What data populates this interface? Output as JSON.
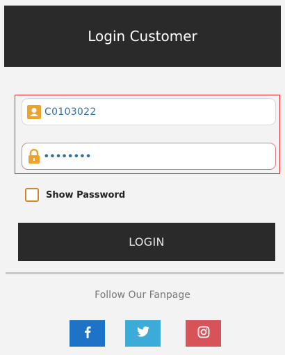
{
  "header": {
    "title": "Login Customer"
  },
  "login_form": {
    "username": {
      "value": "C0103022",
      "icon": "user-icon"
    },
    "password": {
      "value": "••••••••",
      "icon": "lock-icon"
    },
    "show_password": {
      "label": "Show Password",
      "checked": false
    },
    "login_button": {
      "label": "LOGIN"
    }
  },
  "footer": {
    "follow_text": "Follow Our Fanpage",
    "social": [
      {
        "name": "facebook",
        "icon": "facebook-icon",
        "color": "#1f73c7"
      },
      {
        "name": "twitter",
        "icon": "twitter-icon",
        "color": "#3dabd8"
      },
      {
        "name": "instagram",
        "icon": "instagram-icon",
        "color": "#d85357"
      }
    ]
  },
  "colors": {
    "header_bg": "#2a2a2a",
    "accent_icon": "#f0a22e",
    "input_text": "#2e6fa8",
    "highlight": "#e02b2b"
  }
}
